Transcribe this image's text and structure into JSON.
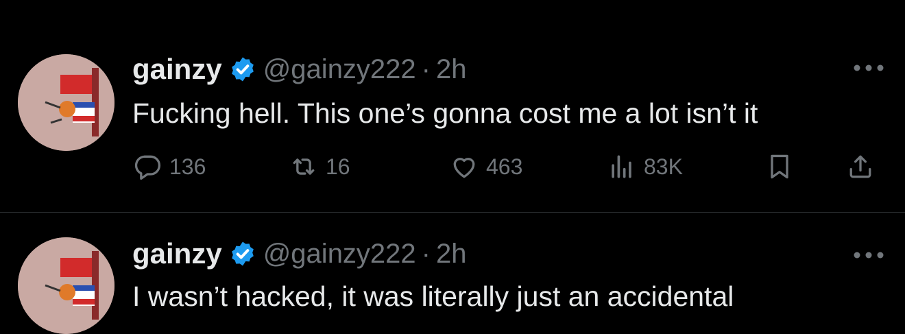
{
  "tweets": [
    {
      "name": "gainzy",
      "handle": "@gainzy222",
      "separator": "·",
      "time": "2h",
      "text": "Fucking hell. This one’s gonna cost me a lot isn’t it",
      "replies": "136",
      "retweets": "16",
      "likes": "463",
      "views": "83K"
    },
    {
      "name": "gainzy",
      "handle": "@gainzy222",
      "separator": "·",
      "time": "2h",
      "text": "I wasn’t hacked, it was literally just an accidental"
    }
  ],
  "icons": {
    "verified": "verified-badge-icon",
    "more": "more-horizontal-icon",
    "reply": "reply-icon",
    "retweet": "retweet-icon",
    "like": "heart-icon",
    "views": "views-chart-icon",
    "bookmark": "bookmark-icon",
    "share": "share-icon"
  },
  "colors": {
    "background": "#000000",
    "text": "#e7e9ea",
    "secondary": "#71767b",
    "verified": "#1d9bf0",
    "divider": "#2f3336"
  }
}
